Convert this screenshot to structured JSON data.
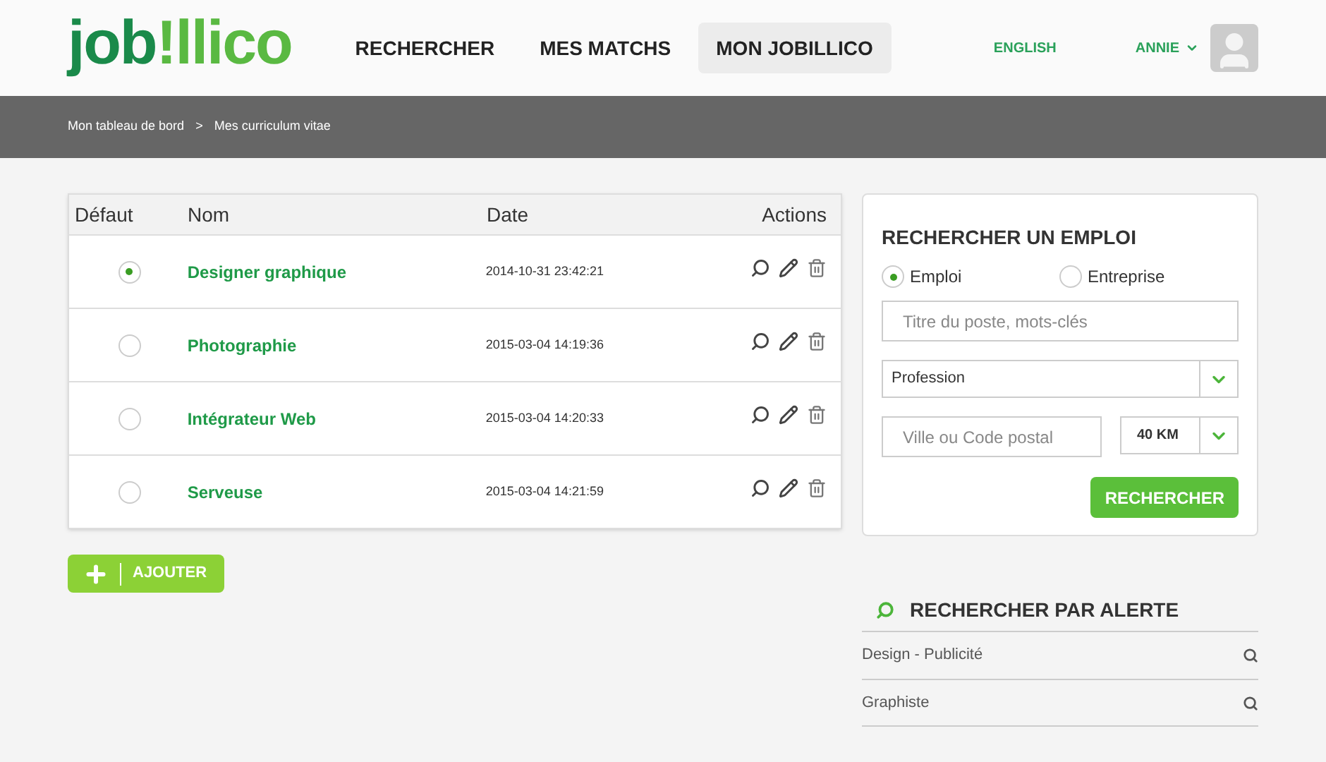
{
  "logo": {
    "part_1": "job",
    "part_2": "!llico"
  },
  "nav": [
    {
      "label": "RECHERCHER",
      "selected": false
    },
    {
      "label": "MES MATCHS",
      "selected": false
    },
    {
      "label": "MON JOBILLICO",
      "selected": true
    }
  ],
  "language": "ENGLISH",
  "user": "ANNIE",
  "breadcrumb": [
    "Mon tableau de bord",
    "Mes curriculum vitae"
  ],
  "breadcrumb_separator": ">",
  "table": {
    "columns": [
      "Défaut",
      "Nom",
      "Date",
      "Actions"
    ],
    "rows": [
      {
        "selected": true,
        "name": "Designer graphique",
        "date": "2014-10-31 23:42:21"
      },
      {
        "selected": false,
        "name": "Photographie",
        "date": "2015-03-04 14:19:36"
      },
      {
        "selected": false,
        "name": "Intégrateur Web",
        "date": "2015-03-04 14:20:33"
      },
      {
        "selected": false,
        "name": "Serveuse",
        "date": "2015-03-04 14:21:59"
      }
    ]
  },
  "add_button": "AJOUTER",
  "search": {
    "title": "RECHERCHER UN EMPLOI",
    "options": [
      {
        "label": "Emploi",
        "selected": true
      },
      {
        "label": "Entreprise",
        "selected": false
      }
    ],
    "keywords": {
      "placeholder": "Titre du poste, mots-clés"
    },
    "profession": "Profession",
    "city": {
      "placeholder": "Ville ou Code postal"
    },
    "distance": "40 KM",
    "button": "RECHERCHER"
  },
  "alerts": {
    "title": "RECHERCHER PAR ALERTE",
    "items": [
      "Design - Publicité",
      "Graphiste"
    ]
  }
}
